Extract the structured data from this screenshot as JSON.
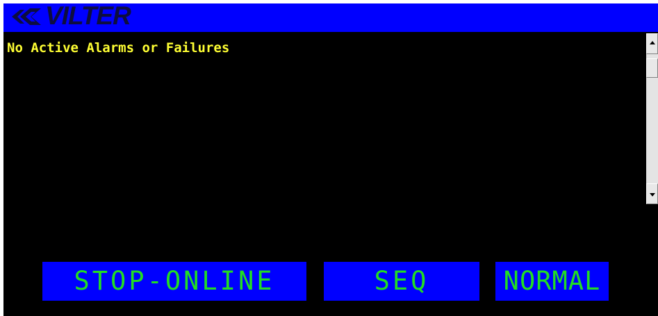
{
  "header": {
    "logo_text": "VILTER",
    "logo_icon": "vilter-logo-icon",
    "background_color": "#0000ff"
  },
  "alarms": {
    "message": "No Active Alarms or Failures",
    "text_color": "#ffff33"
  },
  "status": {
    "run_state": "STOP-ONLINE",
    "mode": "SEQ",
    "condition": "NORMAL",
    "box_color": "#0000ff",
    "text_color": "#22dd22"
  },
  "scrollbar": {
    "up_icon": "scroll-up-arrow-icon",
    "down_icon": "scroll-down-arrow-icon"
  }
}
